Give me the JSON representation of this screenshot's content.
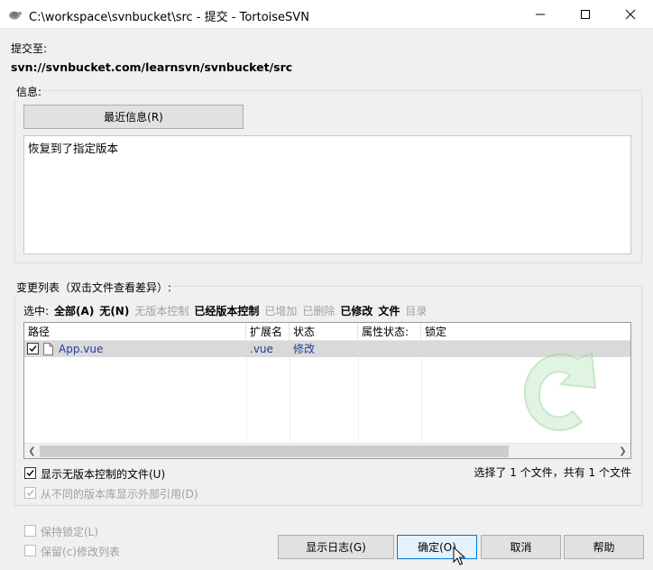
{
  "window": {
    "title": "C:\\workspace\\svnbucket\\src - 提交 - TortoiseSVN",
    "icons": {
      "app": "tortoise-icon",
      "minimize": "minimize-icon",
      "maximize": "maximize-icon",
      "close": "close-icon"
    }
  },
  "commit_to": {
    "label": "提交至:",
    "url": "svn://svnbucket.com/learnsvn/svnbucket/src"
  },
  "message": {
    "group_label": "信息:",
    "recent_button": "最近信息(R)",
    "text": "恢复到了指定版本"
  },
  "changes": {
    "group_label": "变更列表（双击文件查看差异）:",
    "select_label": "选中:",
    "filters": [
      {
        "label": "全部(A)",
        "enabled": true
      },
      {
        "label": "无(N)",
        "enabled": true
      },
      {
        "label": "无版本控制",
        "enabled": false
      },
      {
        "label": "已经版本控制",
        "enabled": true
      },
      {
        "label": "已增加",
        "enabled": false
      },
      {
        "label": "已删除",
        "enabled": false
      },
      {
        "label": "已修改",
        "enabled": true
      },
      {
        "label": "文件",
        "enabled": true
      },
      {
        "label": "目录",
        "enabled": false
      }
    ],
    "columns": [
      "路径",
      "扩展名",
      "状态",
      "属性状态:",
      "锁定"
    ],
    "rows": [
      {
        "checked": true,
        "path": "App.vue",
        "ext": ".vue",
        "status": "修改",
        "prop_status": "",
        "lock": ""
      }
    ],
    "show_unversioned": "显示无版本控制的文件(U)",
    "show_externals": "从不同的版本库显示外部引用(D)",
    "summary": "选择了 1 个文件，共有 1 个文件"
  },
  "options": {
    "keep_locks": "保持锁定(L)",
    "keep_changelist": "保留(c)修改列表"
  },
  "buttons": {
    "show_log": "显示日志(G)",
    "ok": "确定(O)",
    "cancel": "取消",
    "help": "帮助"
  },
  "colors": {
    "accent": "#0078d7",
    "file_text": "#1f3f9a",
    "disabled": "#a0a0a0"
  }
}
